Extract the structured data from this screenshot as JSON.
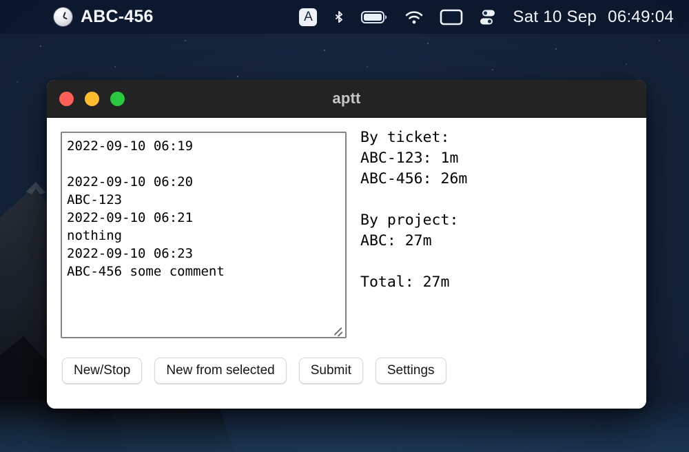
{
  "menubar": {
    "clock_icon": "clock-icon",
    "app_title": "ABC-456",
    "keyboard_layout": "A",
    "icons": [
      {
        "name": "bluetooth-icon",
        "label": "Bluetooth"
      },
      {
        "name": "battery-icon",
        "label": "Battery"
      },
      {
        "name": "wifi-icon",
        "label": "Wi-Fi"
      },
      {
        "name": "screen-mirroring-icon",
        "label": "Screen Mirroring"
      },
      {
        "name": "control-center-icon",
        "label": "Control Center"
      }
    ],
    "date": "Sat 10 Sep",
    "time": "06:49:04"
  },
  "window": {
    "title": "aptt",
    "traffic_lights": {
      "close": "#ff5f57",
      "minimize": "#febc2e",
      "maximize": "#28c840"
    }
  },
  "log": {
    "value": "2022-09-10 06:19\n\n2022-09-10 06:20\nABC-123\n2022-09-10 06:21\nnothing\n2022-09-10 06:23\nABC-456 some comment",
    "placeholder": ""
  },
  "summary": {
    "text": "By ticket:\nABC-123: 1m\nABC-456: 26m\n\nBy project:\nABC: 27m\n\nTotal: 27m",
    "by_ticket_heading": "By ticket:",
    "by_ticket": [
      {
        "ticket": "ABC-123",
        "duration": "1m"
      },
      {
        "ticket": "ABC-456",
        "duration": "26m"
      }
    ],
    "by_project_heading": "By project:",
    "by_project": [
      {
        "project": "ABC",
        "duration": "27m"
      }
    ],
    "total_label": "Total:",
    "total_value": "27m"
  },
  "buttons": [
    {
      "name": "new-stop-button",
      "label": "New/Stop"
    },
    {
      "name": "new-from-selected-button",
      "label": "New from selected"
    },
    {
      "name": "submit-button",
      "label": "Submit"
    },
    {
      "name": "settings-button",
      "label": "Settings"
    }
  ]
}
